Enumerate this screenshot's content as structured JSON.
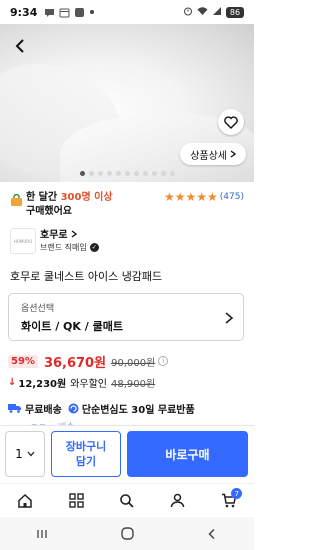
{
  "status": {
    "time": "9:34",
    "battery": "86"
  },
  "hero": {
    "detail_label": "상품상세",
    "total_slides": 11,
    "current_slide": 1
  },
  "buyers": {
    "prefix": "한 달간 ",
    "count": "300명 이상",
    "line2": "구매했어요"
  },
  "rating": {
    "stars": 5,
    "count": "(475)"
  },
  "seller": {
    "logo_text": "HOMURO",
    "name": "호무로",
    "badge": "브랜드 직매입"
  },
  "product": {
    "title": "호무로 쿨네스트 아이스 냉감패드"
  },
  "option": {
    "caption": "옵션선택",
    "value": "화이트 / QK / 쿨매트"
  },
  "price": {
    "discount": "59%",
    "current": "36,670원",
    "original": "90,000원"
  },
  "wow": {
    "arrow": "↓",
    "amount": "12,230원",
    "label": "와우할인",
    "old": "48,900원"
  },
  "shipping": {
    "free_label": "무료배송",
    "return_label": "단순변심도 30일 무료반품"
  },
  "peek_text": "ㅋㅁ... 배송...",
  "buy_bar": {
    "qty": "1",
    "cart_line1": "장바구니",
    "cart_line2": "담기",
    "buy_label": "바로구매"
  },
  "nav": {
    "cart_badge": "7"
  },
  "colors": {
    "accent": "#346aff",
    "price_red": "#e02a2a",
    "star": "#f38a2e",
    "highlight": "#e0522a"
  }
}
